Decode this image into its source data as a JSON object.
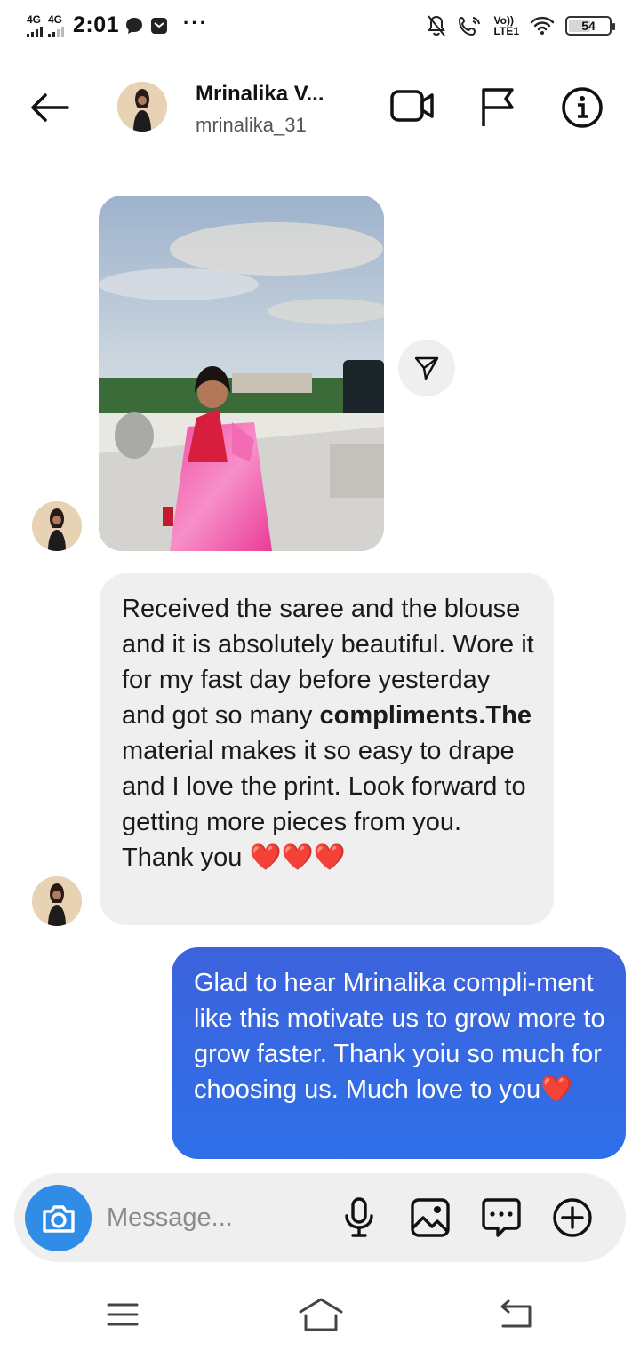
{
  "status_bar": {
    "network_1": "4G",
    "network_2": "4G",
    "time": "2:01",
    "more": "···",
    "volte_top": "Vo))",
    "volte_bottom": "LTE1",
    "battery_level": "54",
    "battery_fraction": 0.54
  },
  "header": {
    "back_icon": "arrow-left-icon",
    "name": "Mrinalika V...",
    "username": "mrinalika_31",
    "video_icon": "video-camera-icon",
    "flag_icon": "flag-icon",
    "info_icon": "info-icon"
  },
  "messages": {
    "photo_icon": "shared-photo",
    "share_icon": "send-icon",
    "received_text_part1": "Received the saree and the blouse and it is absolutely beautiful. Wore it for my fast day before yesterday and got so many ",
    "received_text_bold": "compliments.The",
    "received_text_part2": " material makes it so easy to drape and I love the print. Look forward to getting more pieces from you. Thank you ",
    "received_hearts": "❤️❤️❤️",
    "sent_text": "Glad to hear Mrinalika compli-ment like this motivate us to grow more to grow faster. Thank yoiu so much for choosing us. Much love to you",
    "sent_heart": "❤️"
  },
  "composer": {
    "placeholder": "Message...",
    "camera_icon": "camera-icon",
    "mic_icon": "microphone-icon",
    "gallery_icon": "gallery-icon",
    "sticker_icon": "sticker-icon",
    "plus_icon": "plus-icon"
  },
  "colors": {
    "accent_blue": "#2f6fe8",
    "camera_blue": "#2f8de8",
    "bubble_gray": "#efefef",
    "heart_red": "#d9202e"
  }
}
